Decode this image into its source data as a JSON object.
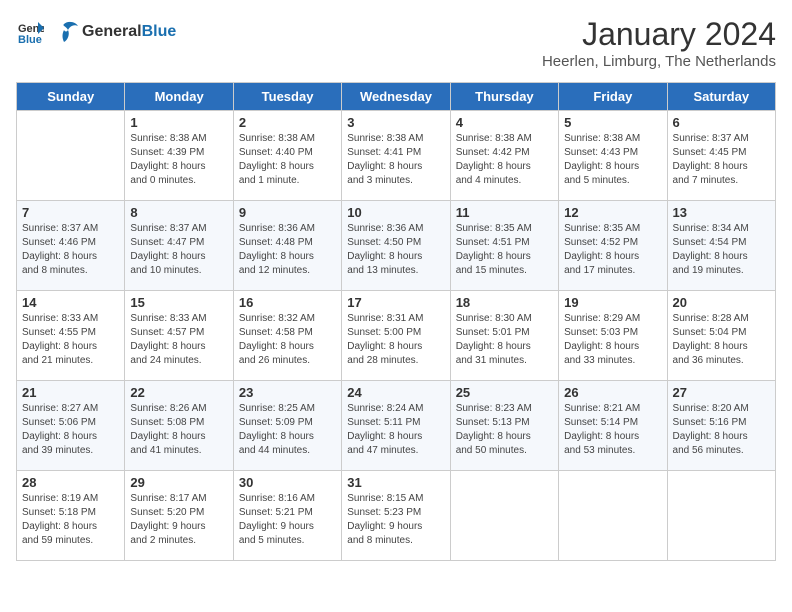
{
  "header": {
    "logo_general": "General",
    "logo_blue": "Blue",
    "month_title": "January 2024",
    "location": "Heerlen, Limburg, The Netherlands"
  },
  "weekdays": [
    "Sunday",
    "Monday",
    "Tuesday",
    "Wednesday",
    "Thursday",
    "Friday",
    "Saturday"
  ],
  "weeks": [
    [
      {
        "day": "",
        "info": ""
      },
      {
        "day": "1",
        "info": "Sunrise: 8:38 AM\nSunset: 4:39 PM\nDaylight: 8 hours\nand 0 minutes."
      },
      {
        "day": "2",
        "info": "Sunrise: 8:38 AM\nSunset: 4:40 PM\nDaylight: 8 hours\nand 1 minute."
      },
      {
        "day": "3",
        "info": "Sunrise: 8:38 AM\nSunset: 4:41 PM\nDaylight: 8 hours\nand 3 minutes."
      },
      {
        "day": "4",
        "info": "Sunrise: 8:38 AM\nSunset: 4:42 PM\nDaylight: 8 hours\nand 4 minutes."
      },
      {
        "day": "5",
        "info": "Sunrise: 8:38 AM\nSunset: 4:43 PM\nDaylight: 8 hours\nand 5 minutes."
      },
      {
        "day": "6",
        "info": "Sunrise: 8:37 AM\nSunset: 4:45 PM\nDaylight: 8 hours\nand 7 minutes."
      }
    ],
    [
      {
        "day": "7",
        "info": "Sunrise: 8:37 AM\nSunset: 4:46 PM\nDaylight: 8 hours\nand 8 minutes."
      },
      {
        "day": "8",
        "info": "Sunrise: 8:37 AM\nSunset: 4:47 PM\nDaylight: 8 hours\nand 10 minutes."
      },
      {
        "day": "9",
        "info": "Sunrise: 8:36 AM\nSunset: 4:48 PM\nDaylight: 8 hours\nand 12 minutes."
      },
      {
        "day": "10",
        "info": "Sunrise: 8:36 AM\nSunset: 4:50 PM\nDaylight: 8 hours\nand 13 minutes."
      },
      {
        "day": "11",
        "info": "Sunrise: 8:35 AM\nSunset: 4:51 PM\nDaylight: 8 hours\nand 15 minutes."
      },
      {
        "day": "12",
        "info": "Sunrise: 8:35 AM\nSunset: 4:52 PM\nDaylight: 8 hours\nand 17 minutes."
      },
      {
        "day": "13",
        "info": "Sunrise: 8:34 AM\nSunset: 4:54 PM\nDaylight: 8 hours\nand 19 minutes."
      }
    ],
    [
      {
        "day": "14",
        "info": "Sunrise: 8:33 AM\nSunset: 4:55 PM\nDaylight: 8 hours\nand 21 minutes."
      },
      {
        "day": "15",
        "info": "Sunrise: 8:33 AM\nSunset: 4:57 PM\nDaylight: 8 hours\nand 24 minutes."
      },
      {
        "day": "16",
        "info": "Sunrise: 8:32 AM\nSunset: 4:58 PM\nDaylight: 8 hours\nand 26 minutes."
      },
      {
        "day": "17",
        "info": "Sunrise: 8:31 AM\nSunset: 5:00 PM\nDaylight: 8 hours\nand 28 minutes."
      },
      {
        "day": "18",
        "info": "Sunrise: 8:30 AM\nSunset: 5:01 PM\nDaylight: 8 hours\nand 31 minutes."
      },
      {
        "day": "19",
        "info": "Sunrise: 8:29 AM\nSunset: 5:03 PM\nDaylight: 8 hours\nand 33 minutes."
      },
      {
        "day": "20",
        "info": "Sunrise: 8:28 AM\nSunset: 5:04 PM\nDaylight: 8 hours\nand 36 minutes."
      }
    ],
    [
      {
        "day": "21",
        "info": "Sunrise: 8:27 AM\nSunset: 5:06 PM\nDaylight: 8 hours\nand 39 minutes."
      },
      {
        "day": "22",
        "info": "Sunrise: 8:26 AM\nSunset: 5:08 PM\nDaylight: 8 hours\nand 41 minutes."
      },
      {
        "day": "23",
        "info": "Sunrise: 8:25 AM\nSunset: 5:09 PM\nDaylight: 8 hours\nand 44 minutes."
      },
      {
        "day": "24",
        "info": "Sunrise: 8:24 AM\nSunset: 5:11 PM\nDaylight: 8 hours\nand 47 minutes."
      },
      {
        "day": "25",
        "info": "Sunrise: 8:23 AM\nSunset: 5:13 PM\nDaylight: 8 hours\nand 50 minutes."
      },
      {
        "day": "26",
        "info": "Sunrise: 8:21 AM\nSunset: 5:14 PM\nDaylight: 8 hours\nand 53 minutes."
      },
      {
        "day": "27",
        "info": "Sunrise: 8:20 AM\nSunset: 5:16 PM\nDaylight: 8 hours\nand 56 minutes."
      }
    ],
    [
      {
        "day": "28",
        "info": "Sunrise: 8:19 AM\nSunset: 5:18 PM\nDaylight: 8 hours\nand 59 minutes."
      },
      {
        "day": "29",
        "info": "Sunrise: 8:17 AM\nSunset: 5:20 PM\nDaylight: 9 hours\nand 2 minutes."
      },
      {
        "day": "30",
        "info": "Sunrise: 8:16 AM\nSunset: 5:21 PM\nDaylight: 9 hours\nand 5 minutes."
      },
      {
        "day": "31",
        "info": "Sunrise: 8:15 AM\nSunset: 5:23 PM\nDaylight: 9 hours\nand 8 minutes."
      },
      {
        "day": "",
        "info": ""
      },
      {
        "day": "",
        "info": ""
      },
      {
        "day": "",
        "info": ""
      }
    ]
  ]
}
